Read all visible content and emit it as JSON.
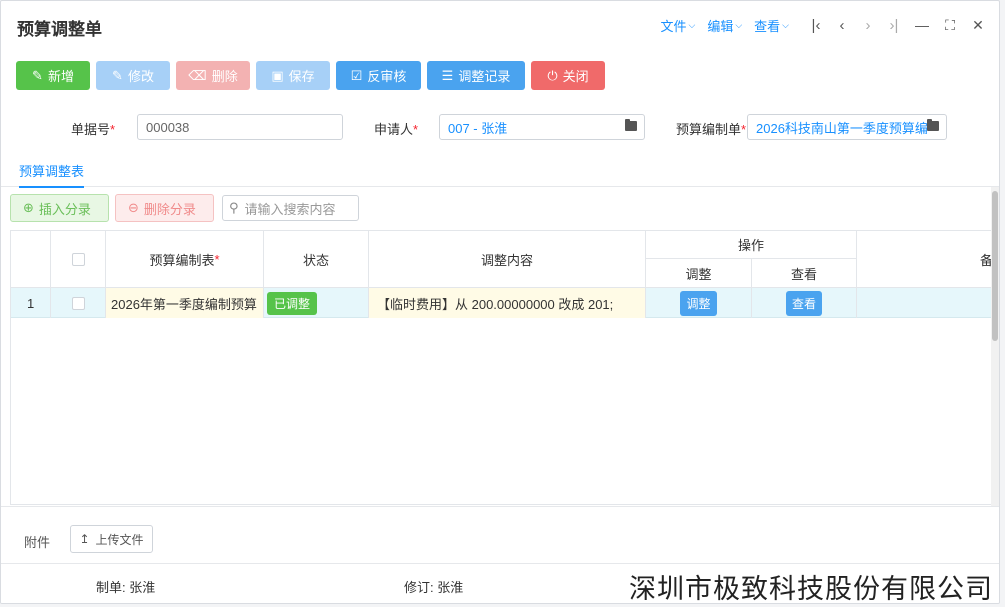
{
  "window": {
    "title": "预算调整单",
    "menus": [
      {
        "label": "文件"
      },
      {
        "label": "编辑"
      },
      {
        "label": "查看"
      }
    ]
  },
  "toolbar": {
    "new_label": "新增",
    "edit_label": "修改",
    "delete_label": "删除",
    "save_label": "保存",
    "unapprove_label": "反审核",
    "history_label": "调整记录",
    "close_label": "关闭"
  },
  "form": {
    "doc_no": {
      "label": "单据号",
      "value": "000038"
    },
    "applicant": {
      "label": "申请人",
      "value": "007 - 张淮"
    },
    "budget_sheet": {
      "label": "预算编制单",
      "value": "2026科技南山第一季度预算编"
    }
  },
  "tabs": [
    {
      "label": "预算调整表"
    }
  ],
  "subtools": {
    "insert_label": "插入分录",
    "remove_label": "删除分录",
    "search_placeholder": "请输入搜索内容"
  },
  "grid": {
    "columns": {
      "budget_table": "预算编制表",
      "status": "状态",
      "content": "调整内容",
      "actions": "操作",
      "adjust": "调整",
      "view": "查看",
      "remark": "备"
    },
    "rows": [
      {
        "index": "1",
        "budget_table": "2026年第一季度编制预算",
        "status": "已调整",
        "content": "【临时费用】从 200.00000000 改成 201;",
        "adjust_btn": "调整",
        "view_btn": "查看"
      }
    ]
  },
  "attachment": {
    "label": "附件",
    "upload_label": "上传文件"
  },
  "footer": {
    "maker": "制单: 张淮",
    "reviser": "修订: 张淮"
  },
  "watermark": "深圳市极致科技股份有限公司",
  "colors": {
    "primary": "#1890ff",
    "green": "#56c34a",
    "red": "#f06a6a",
    "row_highlight": "#e6f7fb"
  }
}
